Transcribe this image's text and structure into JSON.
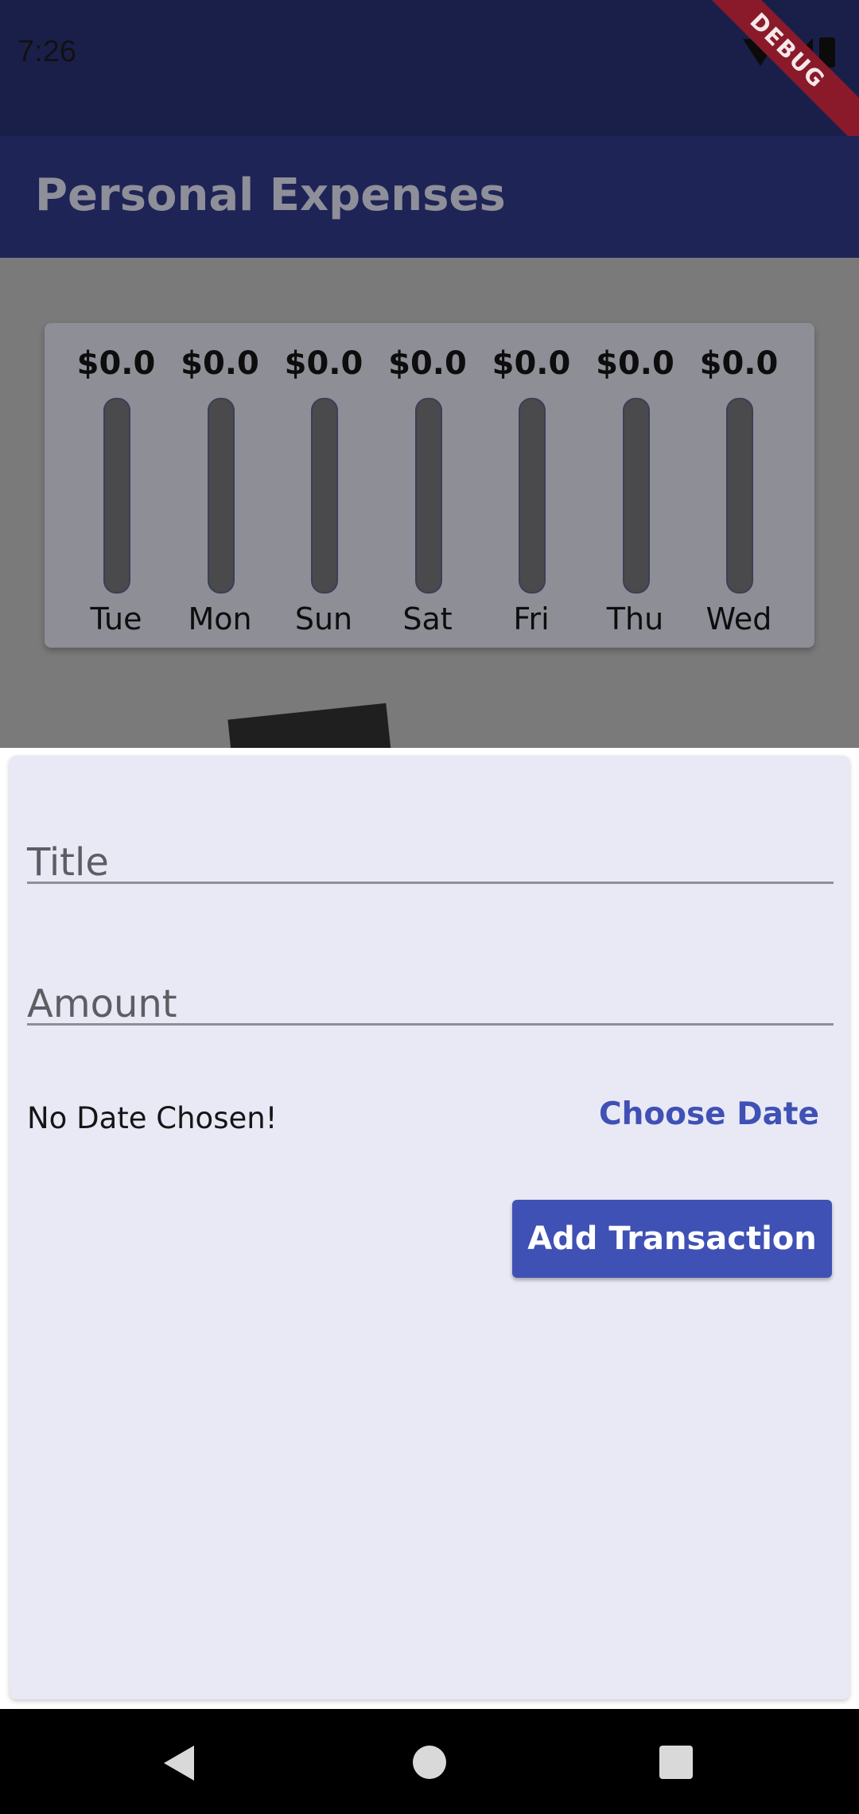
{
  "status_bar": {
    "time": "7:26",
    "debug_label": "DEBUG"
  },
  "app_bar": {
    "title": "Personal Expenses"
  },
  "chart_data": {
    "type": "bar",
    "categories": [
      "Tue",
      "Mon",
      "Sun",
      "Sat",
      "Fri",
      "Thu",
      "Wed"
    ],
    "values": [
      0.0,
      0.0,
      0.0,
      0.0,
      0.0,
      0.0,
      0.0
    ],
    "value_labels": [
      "$0.0",
      "$0.0",
      "$0.0",
      "$0.0",
      "$0.0",
      "$0.0",
      "$0.0"
    ],
    "title": "",
    "xlabel": "",
    "ylabel": "",
    "grid": false
  },
  "form": {
    "title_label": "Title",
    "amount_label": "Amount",
    "title_value": "",
    "amount_value": "",
    "date_status": "No Date Chosen!",
    "choose_date_label": "Choose Date",
    "submit_label": "Add Transaction"
  },
  "colors": {
    "primary": "#3f51b5",
    "app_bar": "#1e2456",
    "sheet": "#e8e9f5"
  },
  "nav": {
    "back_icon": "back-icon",
    "home_icon": "home-icon",
    "recents_icon": "recents-icon"
  }
}
